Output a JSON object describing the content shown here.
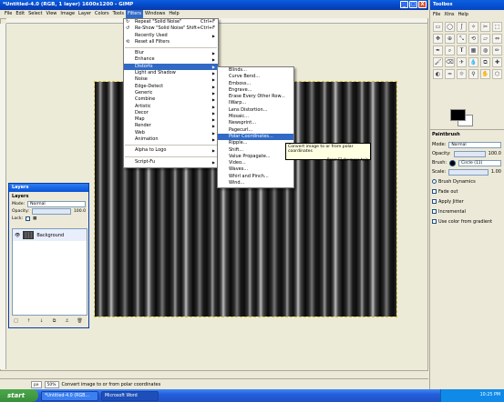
{
  "window": {
    "title": "*Untitled-4.0 (RGB, 1 layer) 1600x1200 - GIMP",
    "controls": [
      "_",
      "□",
      "X"
    ]
  },
  "menubar": [
    "File",
    "Edit",
    "Select",
    "View",
    "Image",
    "Layer",
    "Colors",
    "Tools",
    "Filters",
    "Windows",
    "Help"
  ],
  "filters_menu": {
    "top_items": [
      {
        "label": "Repeat \"Solid Noise\"",
        "shortcut": "Ctrl+F"
      },
      {
        "label": "Re-Show \"Solid Noise\"",
        "shortcut": "Shift+Ctrl+F"
      },
      {
        "label": "Recently Used",
        "shortcut": ""
      },
      {
        "label": "Reset all Filters",
        "shortcut": ""
      }
    ],
    "groups": [
      [
        "Blur",
        "Enhance",
        "Distorts",
        "Light and Shadow",
        "Noise",
        "Edge-Detect",
        "Generic",
        "Combine",
        "Artistic",
        "Decor",
        "Map",
        "Render",
        "Web",
        "Animation"
      ],
      [
        "Alpha to Logo"
      ],
      [
        "Script-Fu"
      ]
    ],
    "highlighted": "Distorts"
  },
  "distorts_menu": {
    "items": [
      "Blinds...",
      "Curve Bend...",
      "Emboss...",
      "Engrave...",
      "Erase Every Other Row...",
      "IWarp...",
      "Lens Distortion...",
      "Mosaic...",
      "Newsprint...",
      "Pagecurl...",
      "Polar Coordinates...",
      "Ripple...",
      "Shift...",
      "Value Propagate...",
      "Video...",
      "Waves...",
      "Whirl and Pinch...",
      "Wind..."
    ],
    "highlighted": "Polar Coordinates..."
  },
  "tooltip": {
    "text": "Convert image to or from polar coordinates",
    "hint": "Press F1 for more help"
  },
  "layers_dialog": {
    "title": "Layers",
    "heading": "Layers",
    "mode_label": "Mode:",
    "mode_value": "Normal",
    "opacity_label": "Opacity:",
    "opacity_value": "100.0",
    "lock_label": "Lock:",
    "layer_name": "Background",
    "buttons": [
      "□",
      "↑",
      "↓",
      "⧉",
      "⚓",
      "🗑"
    ]
  },
  "toolbox": {
    "title": "Toolbox",
    "menu": [
      "File",
      "Xtns",
      "Help"
    ],
    "tools": [
      "▭",
      "◯",
      "ʃ",
      "✧",
      "✂",
      "⬚",
      "✥",
      "⊕",
      "⤡",
      "⟲",
      "▱",
      "⇔",
      "✒",
      "⌕",
      "𝐓",
      "▦",
      "◍",
      "✏",
      "🖌",
      "⌫",
      "✈",
      "💧",
      "⧉",
      "✚",
      "◐",
      "≈",
      "☼",
      "⚲",
      "✋",
      "⬡"
    ]
  },
  "tool_options": {
    "title": "Paintbrush",
    "mode_label": "Mode:",
    "mode_value": "Normal",
    "opacity_label": "Opacity:",
    "opacity_value": "100.0",
    "brush_label": "Brush:",
    "brush_value": "Circle (11)",
    "scale_label": "Scale:",
    "scale_value": "1.00",
    "options": [
      "Brush Dynamics",
      "Fade out",
      "Apply Jitter",
      "Incremental",
      "Use color from gradient"
    ]
  },
  "statusbar": {
    "unit": "px",
    "zoom": "50%",
    "message": "Convert image to or from polar coordinates"
  },
  "taskbar": {
    "start": "start",
    "tasks": [
      "*Untitled-4.0 (RGB...",
      "Microsoft Word"
    ],
    "clock": "10:25 PM"
  },
  "colors": {
    "accent": "#316ac5",
    "titlebar": "#0545c3",
    "foreground": "#000000",
    "background": "#ffffff"
  }
}
